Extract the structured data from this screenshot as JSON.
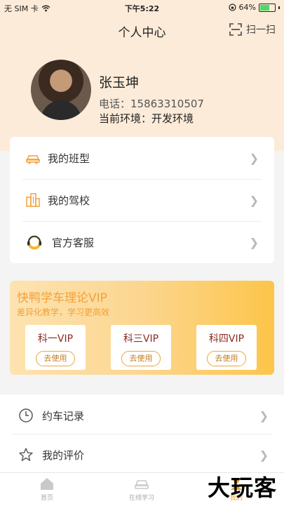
{
  "status_bar": {
    "carrier": "无 SIM 卡",
    "time": "下午5:22",
    "battery": "64%",
    "battery_level": 0.64,
    "icons": [
      "wifi-icon",
      "lock-rotation-icon",
      "battery-icon"
    ]
  },
  "nav": {
    "title": "个人中心",
    "scan_label": "扫一扫"
  },
  "profile": {
    "name": "张玉坤",
    "phone": "电话：15863310507",
    "env": "当前环境：开发环境"
  },
  "menu1": [
    {
      "label": "我的班型",
      "icon": "car-icon"
    },
    {
      "label": "我的驾校",
      "icon": "building-icon"
    },
    {
      "label": "官方客服",
      "icon": "headset-icon"
    }
  ],
  "vip": {
    "title": "快鸭学车理论VIP",
    "subtitle": "差异化教学，学习更高效",
    "items": [
      {
        "name": "科一VIP",
        "button": "去使用"
      },
      {
        "name": "科三VIP",
        "button": "去使用"
      },
      {
        "name": "科四VIP",
        "button": "去使用"
      }
    ]
  },
  "menu2": [
    {
      "label": "约车记录",
      "icon": "clock-icon"
    },
    {
      "label": "我的评价",
      "icon": "star-icon"
    }
  ],
  "tabs": [
    {
      "label": "首页",
      "icon": "home-icon"
    },
    {
      "label": "在线学习",
      "icon": "car-front-icon"
    },
    {
      "label": "我的",
      "icon": "user-icon"
    }
  ],
  "watermark": "大玩客",
  "colors": {
    "accent": "#f3a13a",
    "header_bg": "#fcebd8",
    "vip_gradient_end": "#fcc549"
  }
}
